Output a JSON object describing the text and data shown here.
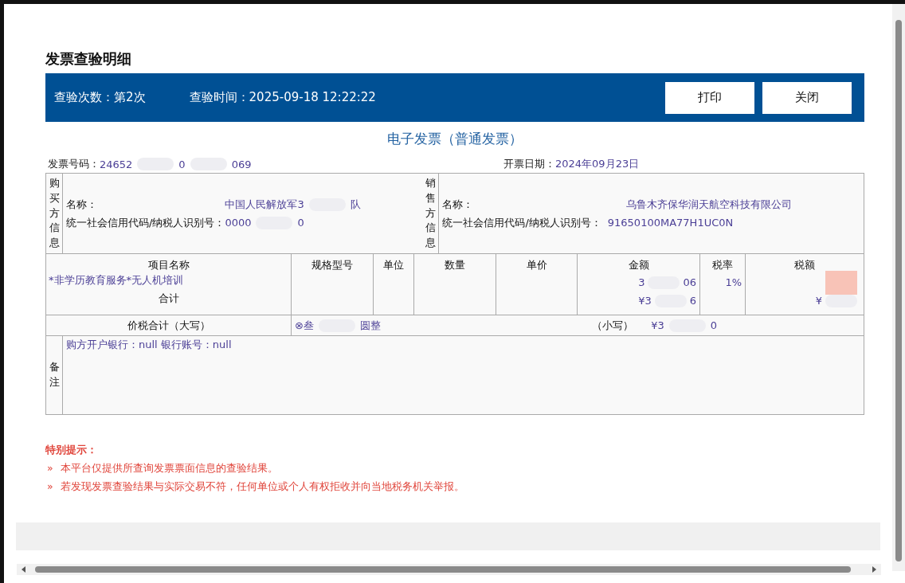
{
  "title": "发票查验明细",
  "check_bar": {
    "count_label": "查验次数：",
    "count_value": "第2次",
    "time_label": "查验时间：",
    "time_value": "2025-09-18 12:22:22",
    "buttons": [
      "打印",
      "关闭"
    ]
  },
  "invoice": {
    "type_title": "电子发票（普通发票）",
    "number_label": "发票号码：",
    "number_parts": [
      "24652",
      "0",
      "069"
    ],
    "date_label": "开票日期：",
    "date_value": "2024年09月23日",
    "buyer": {
      "side_label": "购买方信息",
      "fields": [
        {
          "label": "名称：",
          "parts": [
            "中国人民解放军3",
            "队"
          ]
        },
        {
          "label": "统一社会信用代码/纳税人识别号：",
          "parts": [
            "0000",
            "0"
          ]
        }
      ]
    },
    "seller": {
      "side_label": "销售方信息",
      "fields": [
        {
          "label": "名称：",
          "parts": [
            "乌鲁木齐保华润天航空科技有限公司"
          ]
        },
        {
          "label": "统一社会信用代码/纳税人识别号：",
          "parts": [
            "91650100MA77H1UC0N"
          ]
        }
      ]
    },
    "items": {
      "columns": [
        "项目名称",
        "规格型号",
        "单位",
        "数量",
        "单价",
        "金额",
        "税率",
        "税额"
      ],
      "rows": [
        {
          "name": "*非学历教育服务*无人机培训",
          "amount_parts": [
            "3",
            "06"
          ],
          "rate": "1%",
          "tax_parts": []
        }
      ],
      "total_label": "合计",
      "total_amount_parts": [
        "¥3",
        "6"
      ],
      "total_tax_parts": [
        "¥"
      ]
    },
    "grand_total": {
      "label": "价税合计（大写）",
      "words_parts": [
        "⊗叁",
        "圆整"
      ],
      "small_label": "（小写）",
      "small_parts": [
        "¥3",
        "0"
      ]
    },
    "remarks": {
      "side_label": "备注",
      "text": "购方开户银行：null 银行账号：null"
    }
  },
  "notes": {
    "title": "特别提示：",
    "items": [
      {
        "marker": "»",
        "text": "本平台仅提供所查询发票票面信息的查验结果。"
      },
      {
        "marker": "»",
        "text": "若发现发票查验结果与实际交易不符，任何单位或个人有权拒收并向当地税务机关举报。"
      }
    ]
  }
}
